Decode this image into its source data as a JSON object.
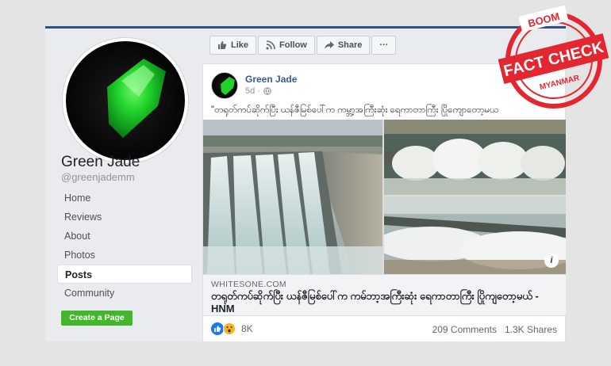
{
  "sidebar": {
    "page_name": "Green Jade",
    "handle": "@greenjademm",
    "nav": [
      "Home",
      "Reviews",
      "About",
      "Photos",
      "Posts",
      "Community"
    ],
    "active_index": 4,
    "cta": "Create a Page"
  },
  "actions": {
    "like": "Like",
    "follow": "Follow",
    "share": "Share",
    "more": "···"
  },
  "post": {
    "author": "Green Jade",
    "time": "5d ·",
    "text": "\"တရုတ်ကပ်ဆိုက်ပြီး ယန်ဇီမြစ်ပေါ်က ကမ္ဘာ့အကြီးဆုံး ရေကာတာကြီး ပြိုကျောတော့မယ",
    "link": {
      "domain": "WHITESONE.COM",
      "title": "တရုတ်ကပ်ဆိုက်ပြီး ယန်ဇီမြစ်ပေါ်က ကမ်ဘာ့အကြီးဆုံး ရေကာတာကြီး ပြိုကျတော့မယ် - HNM"
    },
    "info_label": "i",
    "reaction_count": "8K",
    "comments": "209 Comments",
    "shares": "1.3K Shares"
  },
  "stamp": {
    "top": "BOOM",
    "middle": "FACT CHECK",
    "bottom": "MYANMAR"
  },
  "colors": {
    "fb_blue": "#385898",
    "cta_green": "#42b72a",
    "stamp_red": "#e3262f",
    "jade": "#22c72a"
  },
  "icons": [
    "thumbs-up-icon",
    "rss-icon",
    "share-arrow-icon",
    "globe-icon",
    "info-icon",
    "like-reaction-icon",
    "wow-reaction-icon"
  ]
}
